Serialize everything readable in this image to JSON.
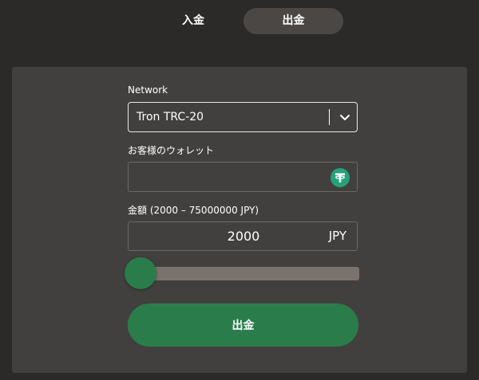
{
  "tabs": {
    "deposit_label": "入金",
    "withdraw_label": "出金",
    "active": "withdraw"
  },
  "form": {
    "network_label": "Network",
    "network_value": "Tron TRC-20",
    "wallet_label": "お客様のウォレット",
    "wallet_value": "",
    "wallet_icon": "tether-icon",
    "amount_label": "金額 (2000 – 75000000 JPY)",
    "amount_value": "2000",
    "amount_currency": "JPY",
    "amount_min": 2000,
    "amount_max": 75000000,
    "slider_fraction": 0,
    "submit_label": "出金"
  },
  "colors": {
    "page_background": "#2c2a28",
    "panel_background": "#42403e",
    "active_tab": "#4a4745",
    "accent_green": "#2a7d4a",
    "slider_track": "#7a726d"
  }
}
